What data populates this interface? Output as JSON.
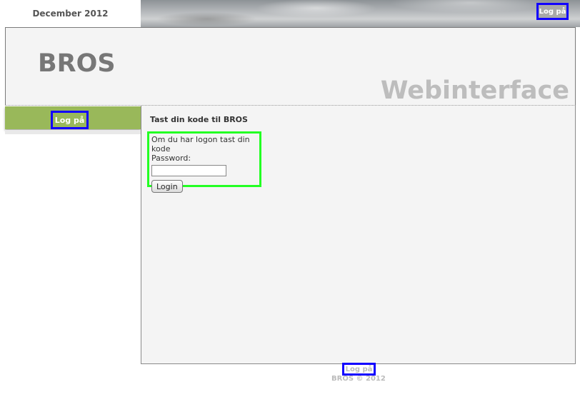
{
  "topbar": {
    "date": "December 2012",
    "login_link": "Log på"
  },
  "header": {
    "logo": "BROS",
    "subtitle": "Webinterface"
  },
  "nav": {
    "login_link": "Log på"
  },
  "content": {
    "title": "Tast din kode til BROS",
    "instruction": "Om du har logon tast din kode",
    "password_label": "Password:",
    "password_value": "",
    "login_button": "Login"
  },
  "footer": {
    "login_link": "Log på",
    "copyright": "BROS © 2012"
  },
  "colors": {
    "nav_green": "#99b85a",
    "highlight_blue": "#1200ff",
    "highlight_green": "#23ff23"
  }
}
